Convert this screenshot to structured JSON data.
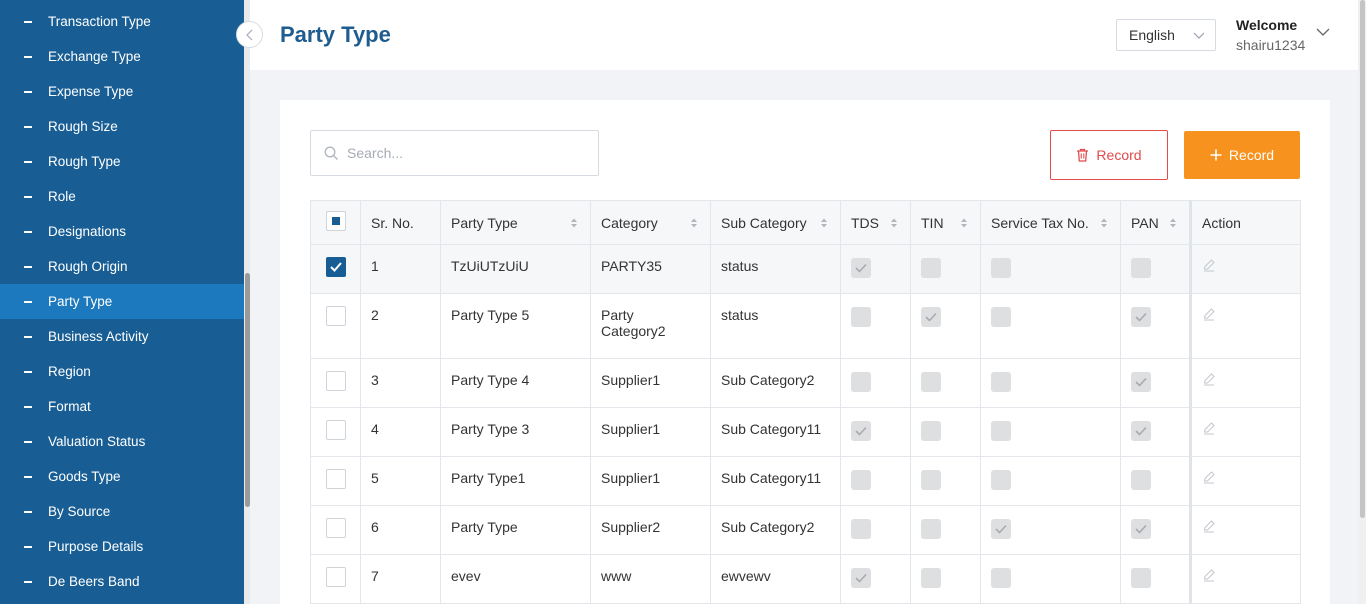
{
  "sidebar": {
    "items": [
      {
        "label": "Transaction Type",
        "active": false
      },
      {
        "label": "Exchange Type",
        "active": false
      },
      {
        "label": "Expense Type",
        "active": false
      },
      {
        "label": "Rough Size",
        "active": false
      },
      {
        "label": "Rough Type",
        "active": false
      },
      {
        "label": "Role",
        "active": false
      },
      {
        "label": "Designations",
        "active": false
      },
      {
        "label": "Rough Origin",
        "active": false
      },
      {
        "label": "Party Type",
        "active": true
      },
      {
        "label": "Business Activity",
        "active": false
      },
      {
        "label": "Region",
        "active": false
      },
      {
        "label": "Format",
        "active": false
      },
      {
        "label": "Valuation Status",
        "active": false
      },
      {
        "label": "Goods Type",
        "active": false
      },
      {
        "label": "By Source",
        "active": false
      },
      {
        "label": "Purpose Details",
        "active": false
      },
      {
        "label": "De Beers Band",
        "active": false
      }
    ]
  },
  "header": {
    "title": "Party Type",
    "language": "English",
    "welcome": "Welcome",
    "username": "shairu1234"
  },
  "toolbar": {
    "search_placeholder": "Search...",
    "search_value": "",
    "delete_label": "Record",
    "add_label": "Record"
  },
  "table": {
    "columns": [
      "Sr. No.",
      "Party Type",
      "Category",
      "Sub Category",
      "TDS",
      "TIN",
      "Service Tax No.",
      "PAN",
      "Action"
    ],
    "rows": [
      {
        "sr": "1",
        "party_type": "TzUiUTzUiU",
        "category": "PARTY35",
        "sub_category": "status",
        "tds": true,
        "tin": false,
        "service_tax": false,
        "pan": false,
        "selected": true
      },
      {
        "sr": "2",
        "party_type": "Party Type 5",
        "category": "Party Category2",
        "sub_category": "status",
        "tds": false,
        "tin": true,
        "service_tax": false,
        "pan": true,
        "selected": false
      },
      {
        "sr": "3",
        "party_type": "Party Type 4",
        "category": "Supplier1",
        "sub_category": "Sub Category2",
        "tds": false,
        "tin": false,
        "service_tax": false,
        "pan": true,
        "selected": false
      },
      {
        "sr": "4",
        "party_type": "Party Type 3",
        "category": "Supplier1",
        "sub_category": "Sub Category11",
        "tds": true,
        "tin": false,
        "service_tax": false,
        "pan": true,
        "selected": false
      },
      {
        "sr": "5",
        "party_type": "Party Type1",
        "category": "Supplier1",
        "sub_category": "Sub Category11",
        "tds": false,
        "tin": false,
        "service_tax": false,
        "pan": false,
        "selected": false
      },
      {
        "sr": "6",
        "party_type": "Party Type",
        "category": "Supplier2",
        "sub_category": "Sub Category2",
        "tds": false,
        "tin": false,
        "service_tax": true,
        "pan": true,
        "selected": false
      },
      {
        "sr": "7",
        "party_type": "evev",
        "category": "www",
        "sub_category": "ewvewv",
        "tds": true,
        "tin": false,
        "service_tax": false,
        "pan": false,
        "selected": false
      }
    ]
  },
  "colors": {
    "sidebar_bg": "#185e94",
    "sidebar_active": "#1d79bd",
    "title": "#1f5c8f",
    "add_button": "#f7921e",
    "delete_button": "#e24b4b"
  }
}
